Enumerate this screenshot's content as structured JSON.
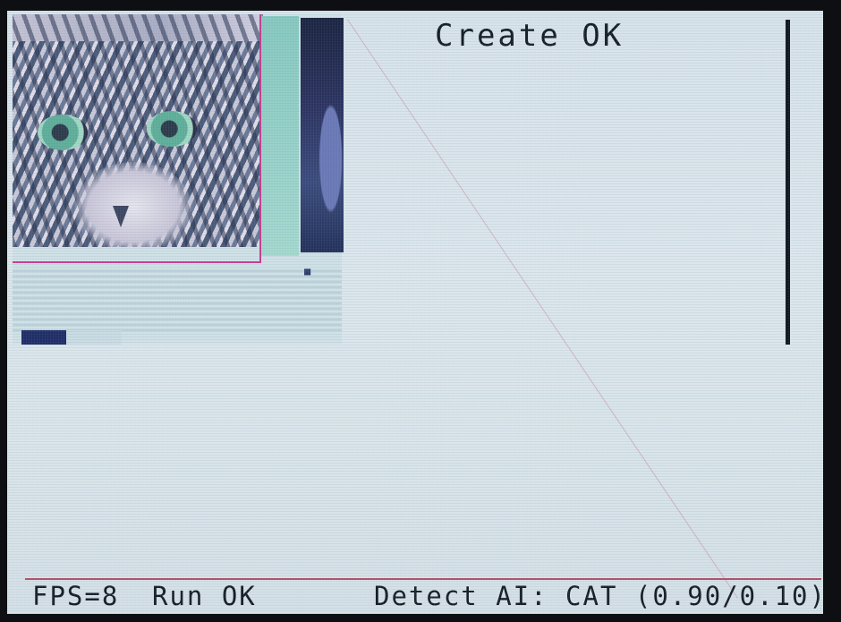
{
  "create_status": "Create OK",
  "camera": {
    "progress_fraction": 0.45,
    "detection_box_color": "#c23d8e"
  },
  "status_bar": {
    "fps": "FPS=8",
    "run": "Run OK",
    "detect": "Detect AI: CAT (0.90/0.10)"
  },
  "icons": {
    "mini_icon": "square-icon"
  },
  "colors": {
    "screen_bg": "#d9e5ea",
    "text": "#141c26",
    "divider": "#b84c64",
    "progress": "#1f2c66"
  }
}
